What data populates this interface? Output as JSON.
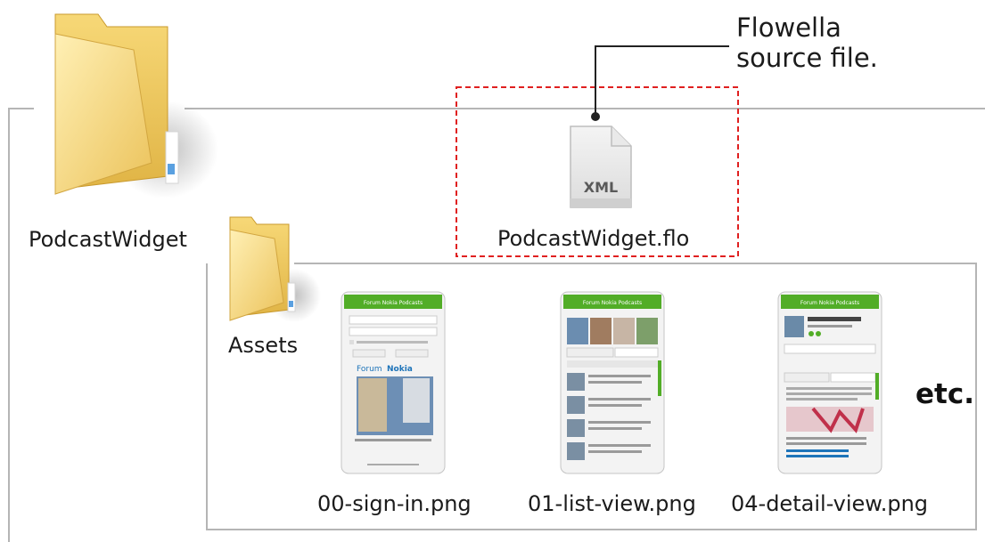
{
  "root_folder": {
    "name": "PodcastWidget",
    "icon": "folder-icon"
  },
  "source_file": {
    "name": "PodcastWidget.flo",
    "badge": "XML",
    "icon": "xml-file-icon",
    "callout": [
      "Flowella",
      "source file."
    ],
    "highlight_color": "#e02020"
  },
  "assets_folder": {
    "name": "Assets",
    "icon": "folder-icon"
  },
  "screens": [
    {
      "file": "00-sign-in.png",
      "header": "Forum Nokia Podcasts",
      "kind": "sign-in"
    },
    {
      "file": "01-list-view.png",
      "header": "Forum Nokia Podcasts",
      "kind": "list"
    },
    {
      "file": "04-detail-view.png",
      "header": "Forum Nokia Podcasts",
      "kind": "detail"
    }
  ],
  "more_label": "etc.",
  "colors": {
    "folder_light": "#fde9a1",
    "folder_dark": "#e9bf4e",
    "phone_header": "#52ad27",
    "frame_line": "#b5b5b5"
  }
}
